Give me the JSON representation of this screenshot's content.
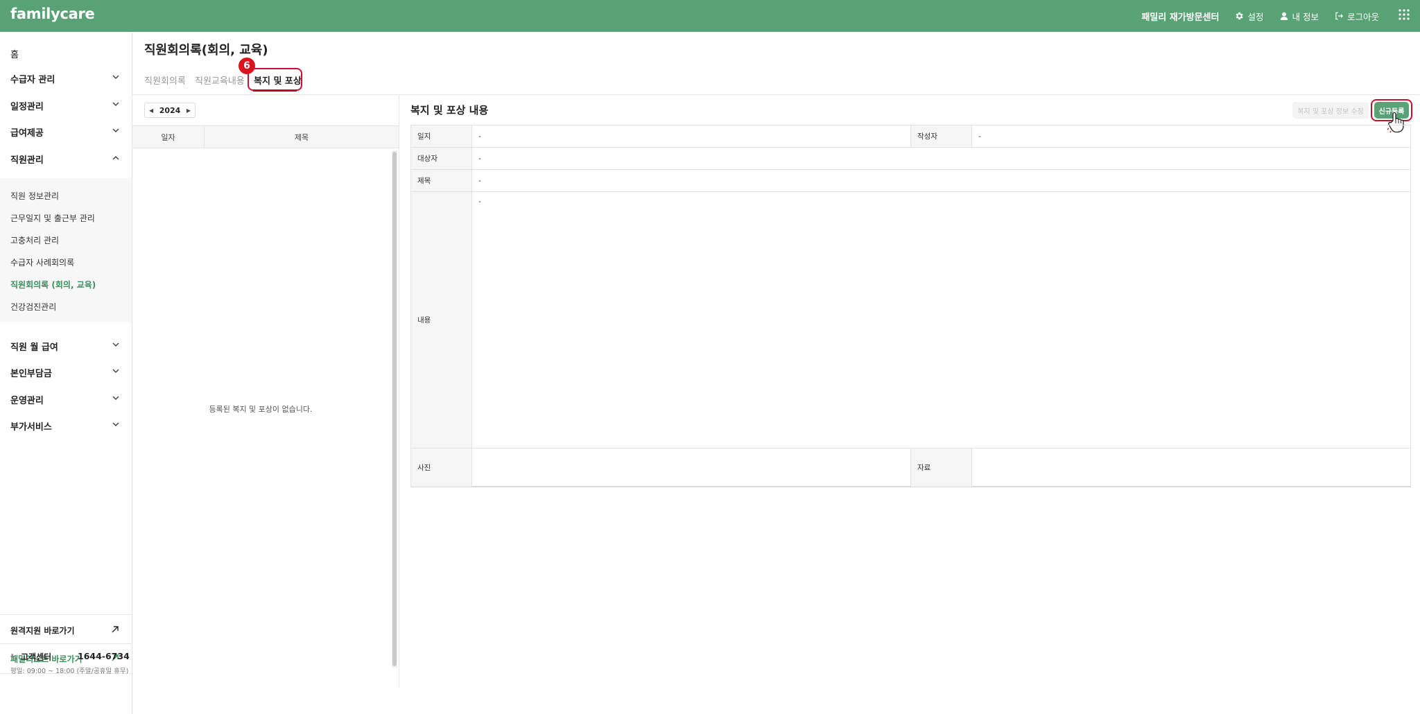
{
  "app": {
    "logo": "familycare",
    "center_name": "패밀리 재가방문센터",
    "nav": {
      "settings": "설정",
      "my_info": "내 정보",
      "logout": "로그아웃"
    }
  },
  "sidebar": {
    "home": "홈",
    "groups": {
      "recipient": "수급자 관리",
      "schedule": "일정관리",
      "benefit": "급여제공",
      "staff": "직원관리",
      "salary": "직원 월 급여",
      "copay": "본인부담금",
      "operation": "운영관리",
      "addon": "부가서비스"
    },
    "staff_sub": [
      "직원 정보관리",
      "근무일지 및 출근부 관리",
      "고충처리 관리",
      "수급자 사례회의록",
      "직원회의록 (회의, 교육)",
      "건강검진관리"
    ],
    "remote_support": "원격지원 바로가기",
    "familynote": "패밀리노트 바로가기",
    "cs_label": "고객센터",
    "cs_phone": "1644-6734",
    "cs_hours": "평일: 09:00 ~ 18:00 (주말/공휴일 휴무)"
  },
  "page": {
    "title": "직원회의록(회의, 교육)",
    "tabs": [
      "직원회의록",
      "직원교육내용",
      "복지 및 포상"
    ],
    "step_badge": "6"
  },
  "list": {
    "year": "2024",
    "col_date": "일자",
    "col_title": "제목",
    "empty": "등록된 복지 및 포상이 없습니다."
  },
  "detail": {
    "title": "복지 및 포상 내용",
    "edit_button": "복지 및 포상 정보 수정",
    "new_button": "신규등록",
    "labels": {
      "date": "일지",
      "author": "작성자",
      "target": "대상자",
      "subject": "제목",
      "content": "내용",
      "photo": "사진",
      "material": "자료"
    },
    "values": {
      "date": "-",
      "author": "-",
      "target": "-",
      "subject": "-",
      "content": "-"
    }
  }
}
